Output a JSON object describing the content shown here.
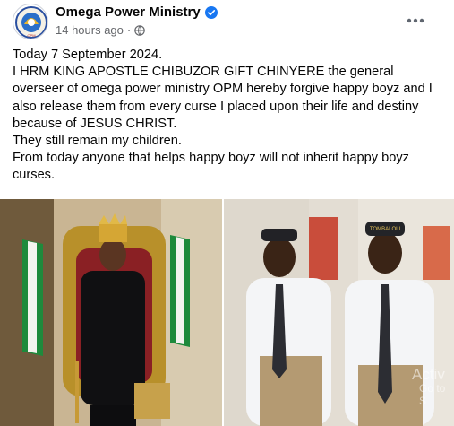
{
  "header": {
    "page_name": "Omega Power Ministry",
    "timestamp": "14 hours ago",
    "separator": "·",
    "verified_icon": "verified-badge-icon",
    "audience_icon": "globe-icon",
    "more_icon": "more-options-icon",
    "colors": {
      "verified": "#1877f2",
      "meta": "#65676b"
    }
  },
  "post": {
    "lines": [
      "Today 7 September 2024.",
      "I HRM KING APOSTLE CHIBUZOR GIFT CHINYERE the general overseer of omega power ministry OPM hereby forgive happy boyz and I also release them from every curse I placed upon their life and destiny because of JESUS CHRIST.",
      "They still remain my children.",
      "From today anyone that helps happy boyz  will not inherit happy boyz curses."
    ]
  },
  "photos": {
    "right_badge_text": "TOMBALOLI",
    "watermark_line1": "Activ",
    "watermark_line2": "Go to S"
  }
}
